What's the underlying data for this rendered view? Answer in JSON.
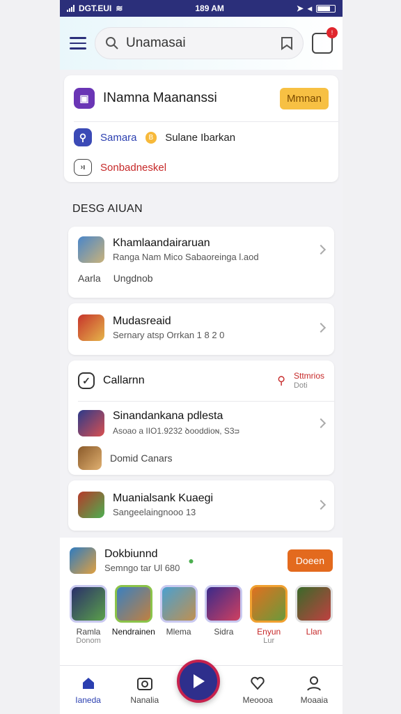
{
  "status": {
    "carrier": "DGT.EUI",
    "time": "189 AM"
  },
  "header": {
    "search_placeholder": "Unamasai"
  },
  "notifications": {
    "count": ""
  },
  "top_card": {
    "title": "INamna Maananssi",
    "action": "Mmnan",
    "row2_label": "Samara",
    "row2_badge": "B",
    "row2_text": "Sulane Ibarkan",
    "row3_text": "Sonbadneskel"
  },
  "section": {
    "label": "DESG AIUAN"
  },
  "items": [
    {
      "title": "Khamlaandairaruan",
      "sub": "Ranga Nam Mico Sabaoreinga l.aod",
      "extra_left": "Aarla",
      "extra_right": "Ungdnob"
    },
    {
      "title": "Mudasreaid",
      "sub": "Sernary atsp Orrkan 1 8 2 0"
    },
    {
      "title": "Callarnn",
      "right_label": "Sttmrios",
      "right_sub": "Doti"
    },
    {
      "title": "Sinandankana pdlesta",
      "sub": "Asoao a IIO1.9232  ꝺooddioɴ, S3ᴝ"
    },
    {
      "title": "Domid Canars"
    },
    {
      "title": "Muanialsank Kuaegi",
      "sub": "Sangeelaingnooo 13"
    }
  ],
  "promo": {
    "title": "Dokbiunnd",
    "sub": "Semngo tar Ul 680",
    "action": "Doeen"
  },
  "grid": [
    {
      "label": "Ramla",
      "sub": "Donom"
    },
    {
      "label": "Nendrainen",
      "sub": ""
    },
    {
      "label": "Mlema",
      "sub": ""
    },
    {
      "label": "Sidra",
      "sub": ""
    },
    {
      "label": "Enyun",
      "sub": "Lur"
    },
    {
      "label": "Llan",
      "sub": ""
    }
  ],
  "nav": {
    "home": "Ianeda",
    "media": "Nanalia",
    "fav": "Meoooa",
    "profile": "Moaaia"
  },
  "colors": {
    "brand": "#2b2f7a",
    "accent_red": "#c6224e",
    "yellow": "#f7c043",
    "orange": "#e36a1e"
  }
}
